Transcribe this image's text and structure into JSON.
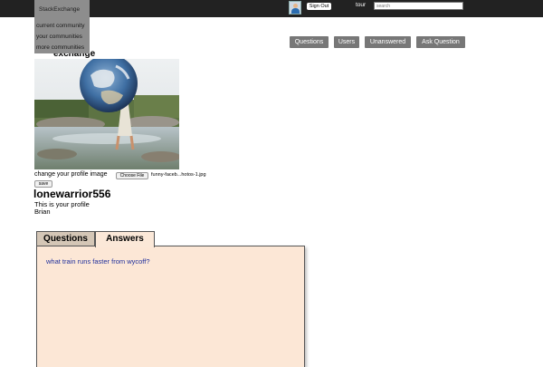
{
  "topbar": {
    "site_switcher": "StackExchange",
    "communities_menu": [
      "current community",
      "your communities",
      "more communities"
    ],
    "sign_out_label": "Sign Out",
    "tour_label": "tour",
    "search_placeholder": "search"
  },
  "nav": {
    "buttons": [
      "Questions",
      "Users",
      "Unanswered",
      "Ask Question"
    ]
  },
  "logo_text": "exchange",
  "profile": {
    "change_image_label": "change your profile image",
    "choose_file_label": "Choose File",
    "file_name": "funny-faceb...hotos-1.jpg",
    "save_label": "save",
    "username": "lonewarrior556",
    "note": "This is your profile",
    "real_name": "Brian"
  },
  "tabs": {
    "items": [
      "Questions",
      "Answers"
    ],
    "active": "Answers"
  },
  "answers": [
    "what train runs faster from wycoff?"
  ],
  "colors": {
    "topbar": "#222222",
    "nav_button": "#777777",
    "active_tab": "#fbe8d8",
    "inactive_tab": "#d4c6b6",
    "panel": "#fce7d6",
    "link": "#1f2f9c"
  }
}
